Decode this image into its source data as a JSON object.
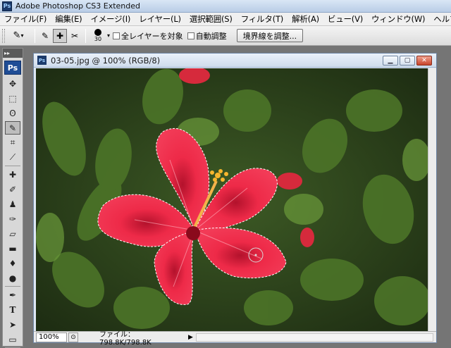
{
  "app": {
    "title": "Adobe Photoshop CS3 Extended",
    "badge": "Ps"
  },
  "menu": [
    "ファイル(F)",
    "編集(E)",
    "イメージ(I)",
    "レイヤー(L)",
    "選択範囲(S)",
    "フィルタ(T)",
    "解析(A)",
    "ビュー(V)",
    "ウィンドウ(W)",
    "ヘルプ(H)"
  ],
  "options": {
    "brush_size": "30",
    "sample_all_layers": "全レイヤーを対象",
    "auto_enhance": "自動調整",
    "refine_edge": "境界線を調整..."
  },
  "toolbox": {
    "logo": "Ps",
    "grip": "▸▸"
  },
  "document": {
    "title": "03-05.jpg @ 100% (RGB/8)",
    "badge": "Ps",
    "zoom": "100%",
    "file_info": "ファイル：798.8K/798.8K"
  },
  "colors": {
    "flower": "#e8213f",
    "leaf": "#4f7a2a",
    "background": "#2f4420"
  },
  "icons": [
    "quick-selection-icon",
    "new-selection-icon",
    "add-to-selection-icon",
    "subtract-selection-icon",
    "brush-tip-icon",
    "minimize-icon",
    "maximize-icon",
    "close-icon"
  ]
}
